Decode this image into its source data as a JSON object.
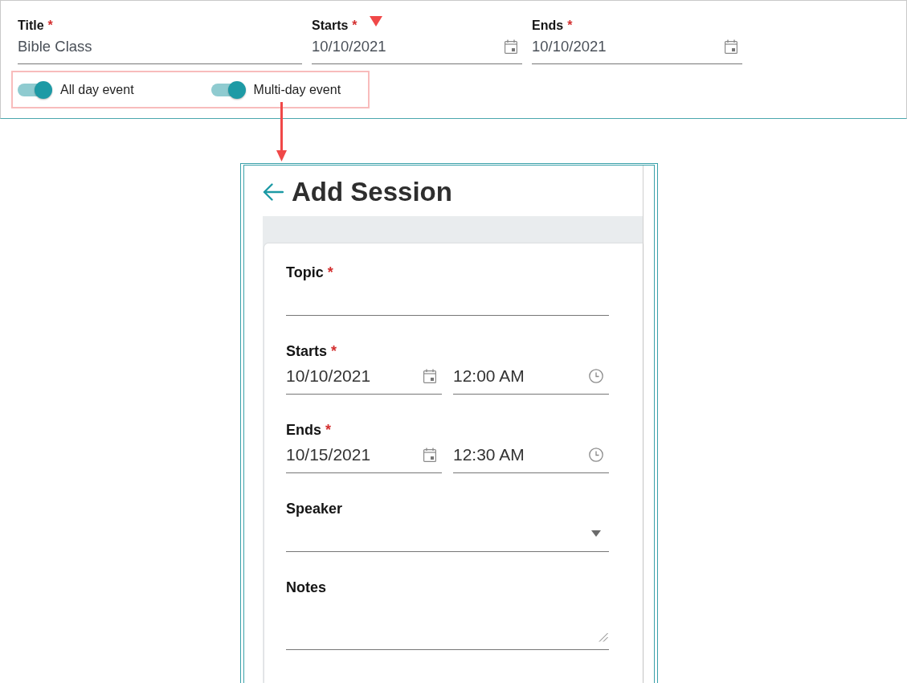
{
  "event_form": {
    "fields": [
      {
        "kind": "text",
        "label": "Title",
        "required_mark": "*",
        "value": "Bible Class"
      },
      {
        "kind": "date",
        "label": "Starts",
        "required_mark": "*",
        "value": "10/10/2021"
      },
      {
        "kind": "date",
        "label": "Ends",
        "required_mark": "*",
        "value": "10/10/2021"
      }
    ],
    "toggles": [
      {
        "label": "All day event",
        "on": true
      },
      {
        "label": "Multi-day event",
        "on": true
      }
    ]
  },
  "session_panel": {
    "title": "Add Session",
    "fields": [
      {
        "kind": "text",
        "label": "Topic",
        "required_mark": "*"
      },
      {
        "kind": "datetime",
        "label": "Starts",
        "required_mark": "*",
        "date": "10/10/2021",
        "time": "12:00 AM"
      },
      {
        "kind": "datetime",
        "label": "Ends",
        "required_mark": "*",
        "date": "10/15/2021",
        "time": "12:30 AM"
      },
      {
        "kind": "select",
        "label": "Speaker"
      },
      {
        "kind": "textarea",
        "label": "Notes"
      }
    ]
  }
}
